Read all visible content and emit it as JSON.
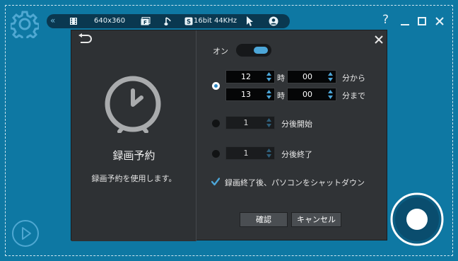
{
  "toolbar": {
    "resolution": "640x360",
    "audio_format": "16bit 44KHz",
    "help": "?",
    "minimize": "_",
    "maximize": "☐",
    "close": "✕"
  },
  "dialog": {
    "title": "録画予約",
    "description": "録画予約を使用します。",
    "on_label": "オン",
    "close": "✕",
    "time_range": {
      "start_hour": "12",
      "start_hour_unit": "時",
      "start_minute": "00",
      "start_suffix": "分から",
      "end_hour": "13",
      "end_hour_unit": "時",
      "end_minute": "00",
      "end_suffix": "分まで"
    },
    "start_after": {
      "value": "1",
      "suffix": "分後開始"
    },
    "end_after": {
      "value": "1",
      "suffix": "分後終了"
    },
    "shutdown_label": "録画終了後、パソコンをシャットダウン",
    "ok_button": "確認",
    "cancel_button": "キャンセル"
  },
  "colors": {
    "background": "#0e78a3",
    "dialog": "#303336",
    "accent": "#4ca6d8"
  }
}
